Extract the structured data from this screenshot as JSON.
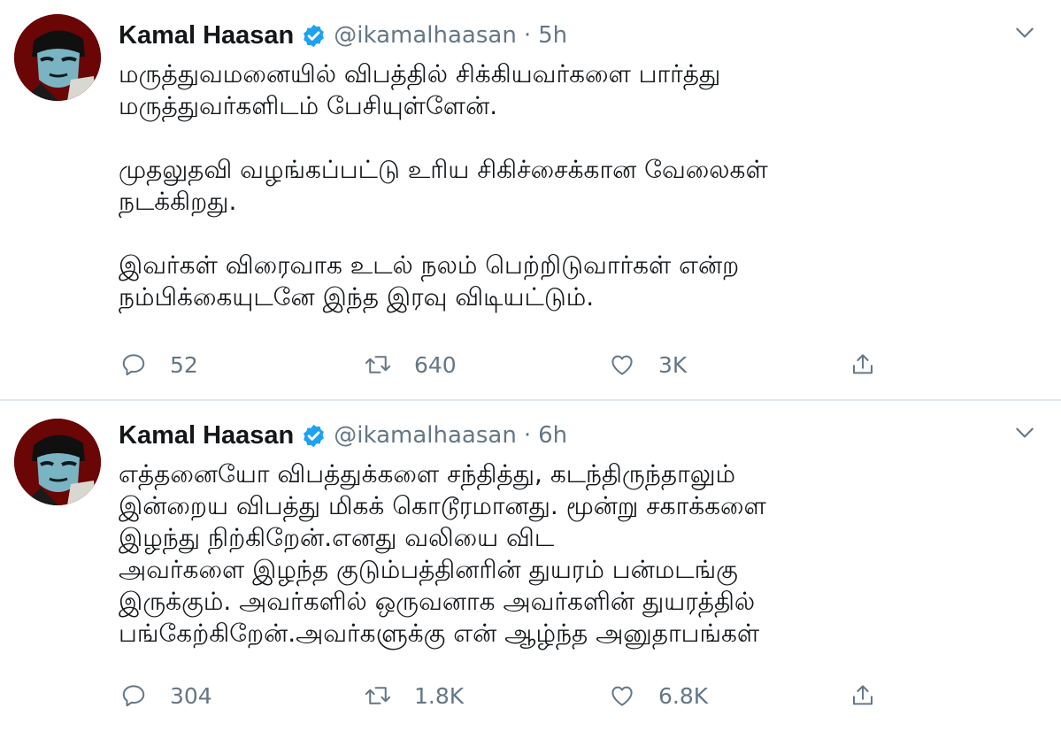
{
  "tweets": [
    {
      "name": "Kamal Haasan",
      "handle": "@ikamalhaasan",
      "separator": "·",
      "time": "5h",
      "text": "மருத்துவமனையில் விபத்தில் சிக்கியவர்களை பார்த்து\nமருத்துவர்களிடம் பேசியுள்ளேன்.\n\nமுதலுதவி வழங்கப்பட்டு உரிய சிகிச்சைக்கான வேலைகள்\nநடக்கிறது.\n\nஇவர்கள் விரைவாக உடல் நலம் பெற்றிடுவார்கள் என்ற\nநம்பிக்கையுடனே இந்த இரவு விடியட்டும்.",
      "replies": "52",
      "retweets": "640",
      "likes": "3K"
    },
    {
      "name": "Kamal Haasan",
      "handle": "@ikamalhaasan",
      "separator": "·",
      "time": "6h",
      "text": "எத்தனையோ விபத்துக்களை சந்தித்து, கடந்திருந்தாலும்\nஇன்றைய விபத்து மிகக் கொடூரமானது. மூன்று சகாக்களை\nஇழந்து நிற்கிறேன்.எனது வலியை விட\nஅவர்களை இழந்த குடும்பத்தினரின் துயரம் பன்மடங்கு\nஇருக்கும். அவர்களில் ஒருவனாக அவர்களின் துயரத்தில்\nபங்கேற்கிறேன்.அவர்களுக்கு என் ஆழ்ந்த அனுதாபங்கள்",
      "replies": "304",
      "retweets": "1.8K",
      "likes": "6.8K"
    }
  ],
  "colors": {
    "text": "#14171a",
    "secondary": "#657786",
    "verified": "#1da1f2",
    "divider": "#e1e8ed",
    "avatar_bg": "#6a0606"
  },
  "icons": {
    "verified": "verified-badge-icon",
    "caret": "chevron-down-icon",
    "reply": "reply-icon",
    "retweet": "retweet-icon",
    "like": "heart-icon",
    "share": "share-icon"
  }
}
